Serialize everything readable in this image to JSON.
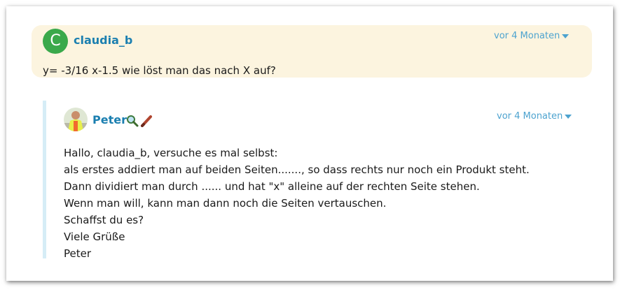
{
  "question": {
    "avatar_letter": "C",
    "username": "claudia_b",
    "timestamp": "vor 4 Monaten",
    "text": "y= -3/16 x-1.5 wie löst man das nach X auf?"
  },
  "answer": {
    "username": "Peter",
    "timestamp": "vor 4 Monaten",
    "badges": [
      "magnifier-icon",
      "pencil-icon"
    ],
    "lines": [
      "Hallo, claudia_b, versuche es mal selbst:",
      "als erstes addiert man auf beiden Seiten......., so dass rechts nur noch ein Produkt steht.",
      "Dann dividiert man durch ...... und hat \"x\" alleine auf der rechten Seite stehen.",
      "Wenn man will, kann man dann noch die Seiten vertauschen.",
      "Schaffst du es?",
      "Viele Grüße",
      "Peter"
    ]
  },
  "colors": {
    "question_bg": "#fcf4df",
    "username": "#1b7fb0",
    "timestamp": "#4da3cf",
    "avatar_green": "#3aa94b",
    "answer_border": "#d6edf6"
  }
}
